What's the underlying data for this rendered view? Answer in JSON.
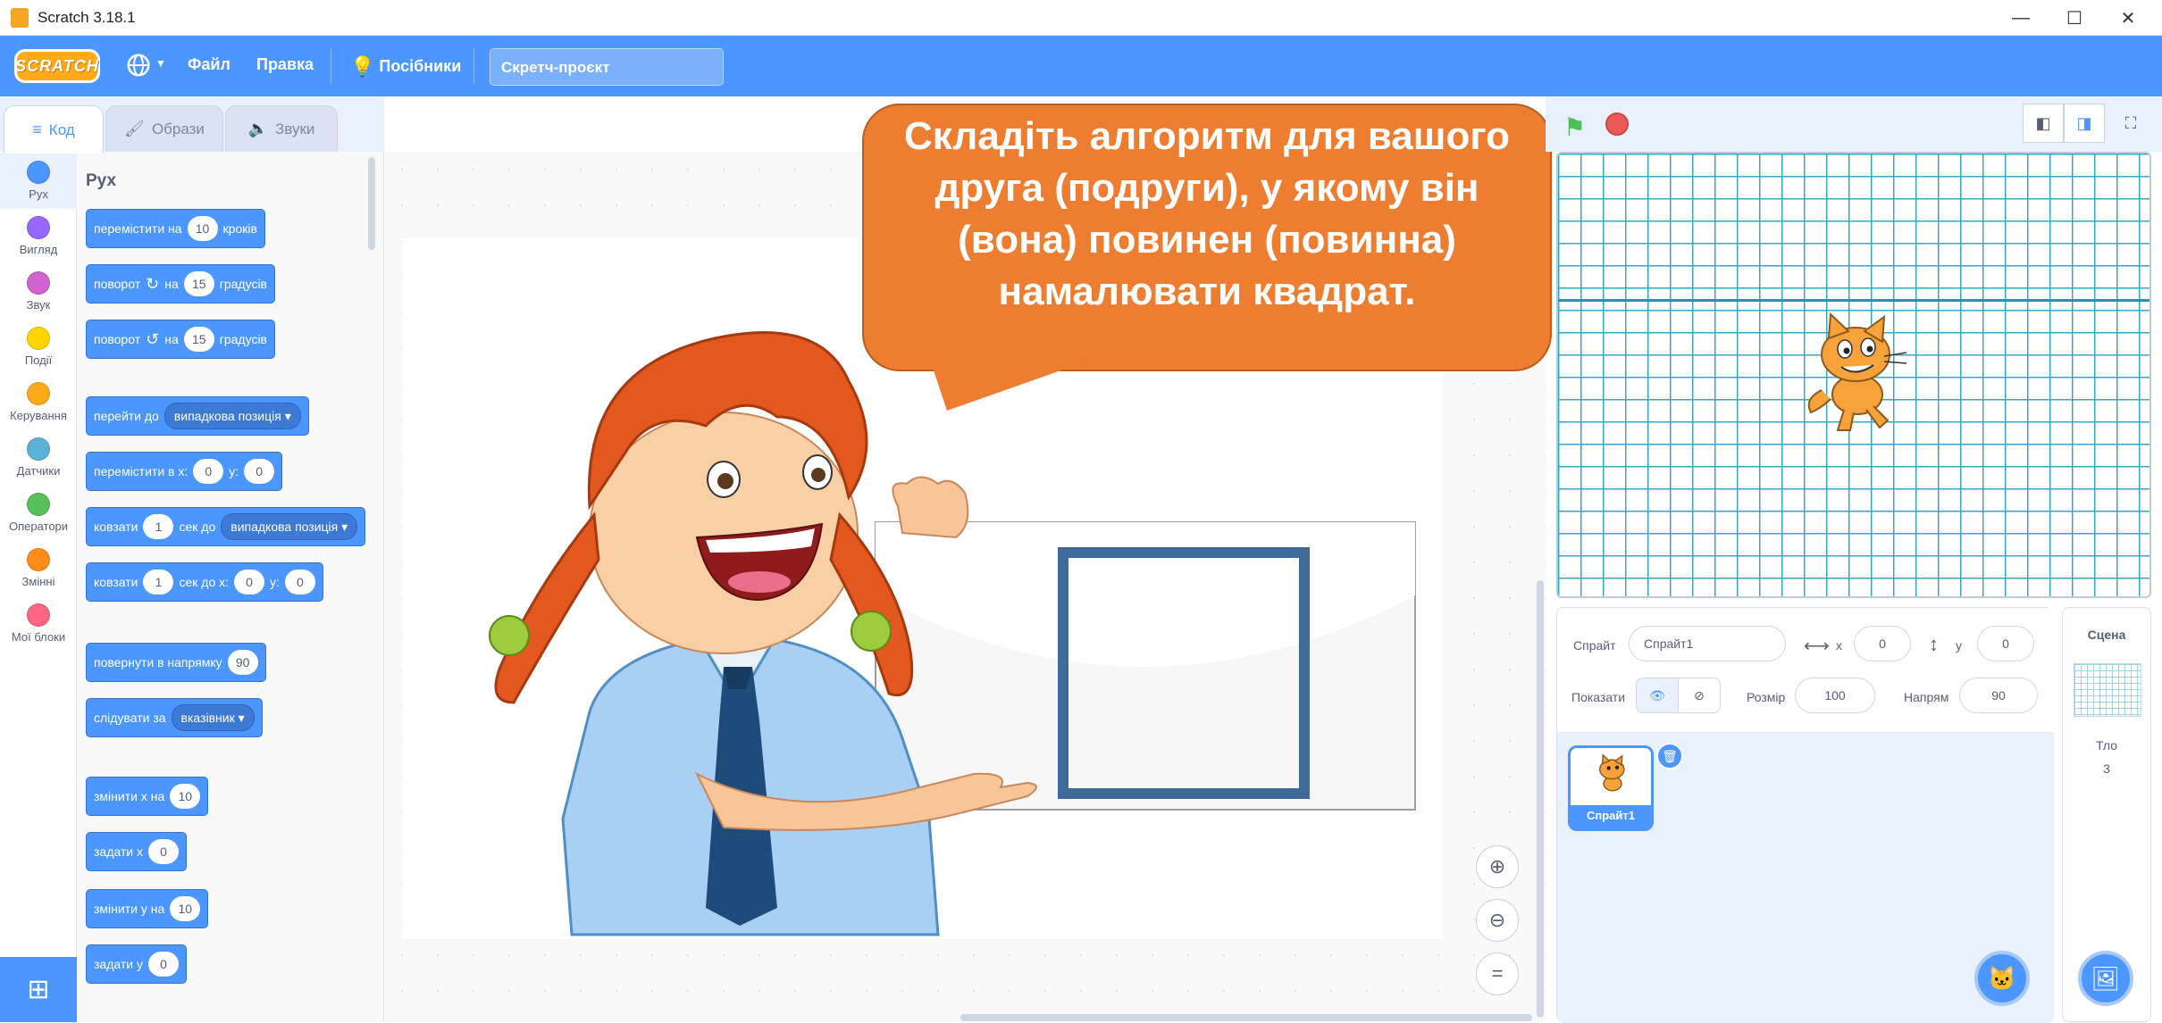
{
  "window": {
    "title": "Scratch 3.18.1",
    "minimize": "—",
    "maximize": "☐",
    "close": "✕"
  },
  "menubar": {
    "logo": "SCRATCH",
    "language_icon": "globe-icon",
    "file": "Файл",
    "edit": "Правка",
    "tutorials": "Посібники",
    "project_title": "Скретч-проєкт"
  },
  "tabs": {
    "code": "Код",
    "costumes": "Образи",
    "sounds": "Звуки"
  },
  "categories": [
    {
      "label": "Рух",
      "color": "#4c97ff"
    },
    {
      "label": "Вигляд",
      "color": "#9966ff"
    },
    {
      "label": "Звук",
      "color": "#cf63cf"
    },
    {
      "label": "Події",
      "color": "#ffd500"
    },
    {
      "label": "Керування",
      "color": "#ffab19"
    },
    {
      "label": "Датчики",
      "color": "#5cb1d6"
    },
    {
      "label": "Оператори",
      "color": "#59c059"
    },
    {
      "label": "Змінні",
      "color": "#ff8c1a"
    },
    {
      "label": "Мої блоки",
      "color": "#ff6680"
    }
  ],
  "palette": {
    "heading": "Рух",
    "move": {
      "a": "перемістити на",
      "v": "10",
      "b": "кроків"
    },
    "turn_right": {
      "a": "поворот",
      "b": "на",
      "v": "15",
      "c": "градусів"
    },
    "turn_left": {
      "a": "поворот",
      "b": "на",
      "v": "15",
      "c": "градусів"
    },
    "goto": {
      "a": "перейти до",
      "d": "випадкова позиція"
    },
    "goto_xy": {
      "a": "перемістити в x:",
      "x": "0",
      "b": "y:",
      "y": "0"
    },
    "glide": {
      "a": "ковзати",
      "v": "1",
      "b": "сек до",
      "d": "випадкова позиція"
    },
    "glide_xy": {
      "a": "ковзати",
      "v": "1",
      "b": "сек до x:",
      "x": "0",
      "c": "y:",
      "y": "0"
    },
    "point_dir": {
      "a": "повернути в напрямку",
      "v": "90"
    },
    "point_towards": {
      "a": "слідувати за",
      "d": "вказівник"
    },
    "change_x": {
      "a": "змінити х на",
      "v": "10"
    },
    "set_x": {
      "a": "задати х",
      "v": "0"
    },
    "change_y": {
      "a": "змінити у на",
      "v": "10"
    },
    "set_y": {
      "a": "задати у",
      "v": "0"
    }
  },
  "speech_bubble": "Складіть алгоритм для вашого друга (подруги), у якому він (вона) повинен (повинна) намалювати квадрат.",
  "sprite_info": {
    "sprite_label": "Спрайт",
    "sprite_name": "Спрайт1",
    "x_label": "x",
    "x": "0",
    "y_label": "y",
    "y": "0",
    "show_label": "Показати",
    "size_label": "Розмір",
    "size": "100",
    "direction_label": "Напрям",
    "direction": "90"
  },
  "sprites": [
    {
      "name": "Спрайт1"
    }
  ],
  "stage_pane": {
    "title": "Сцена",
    "backdrops_label": "Тло",
    "backdrops_count": "3"
  }
}
